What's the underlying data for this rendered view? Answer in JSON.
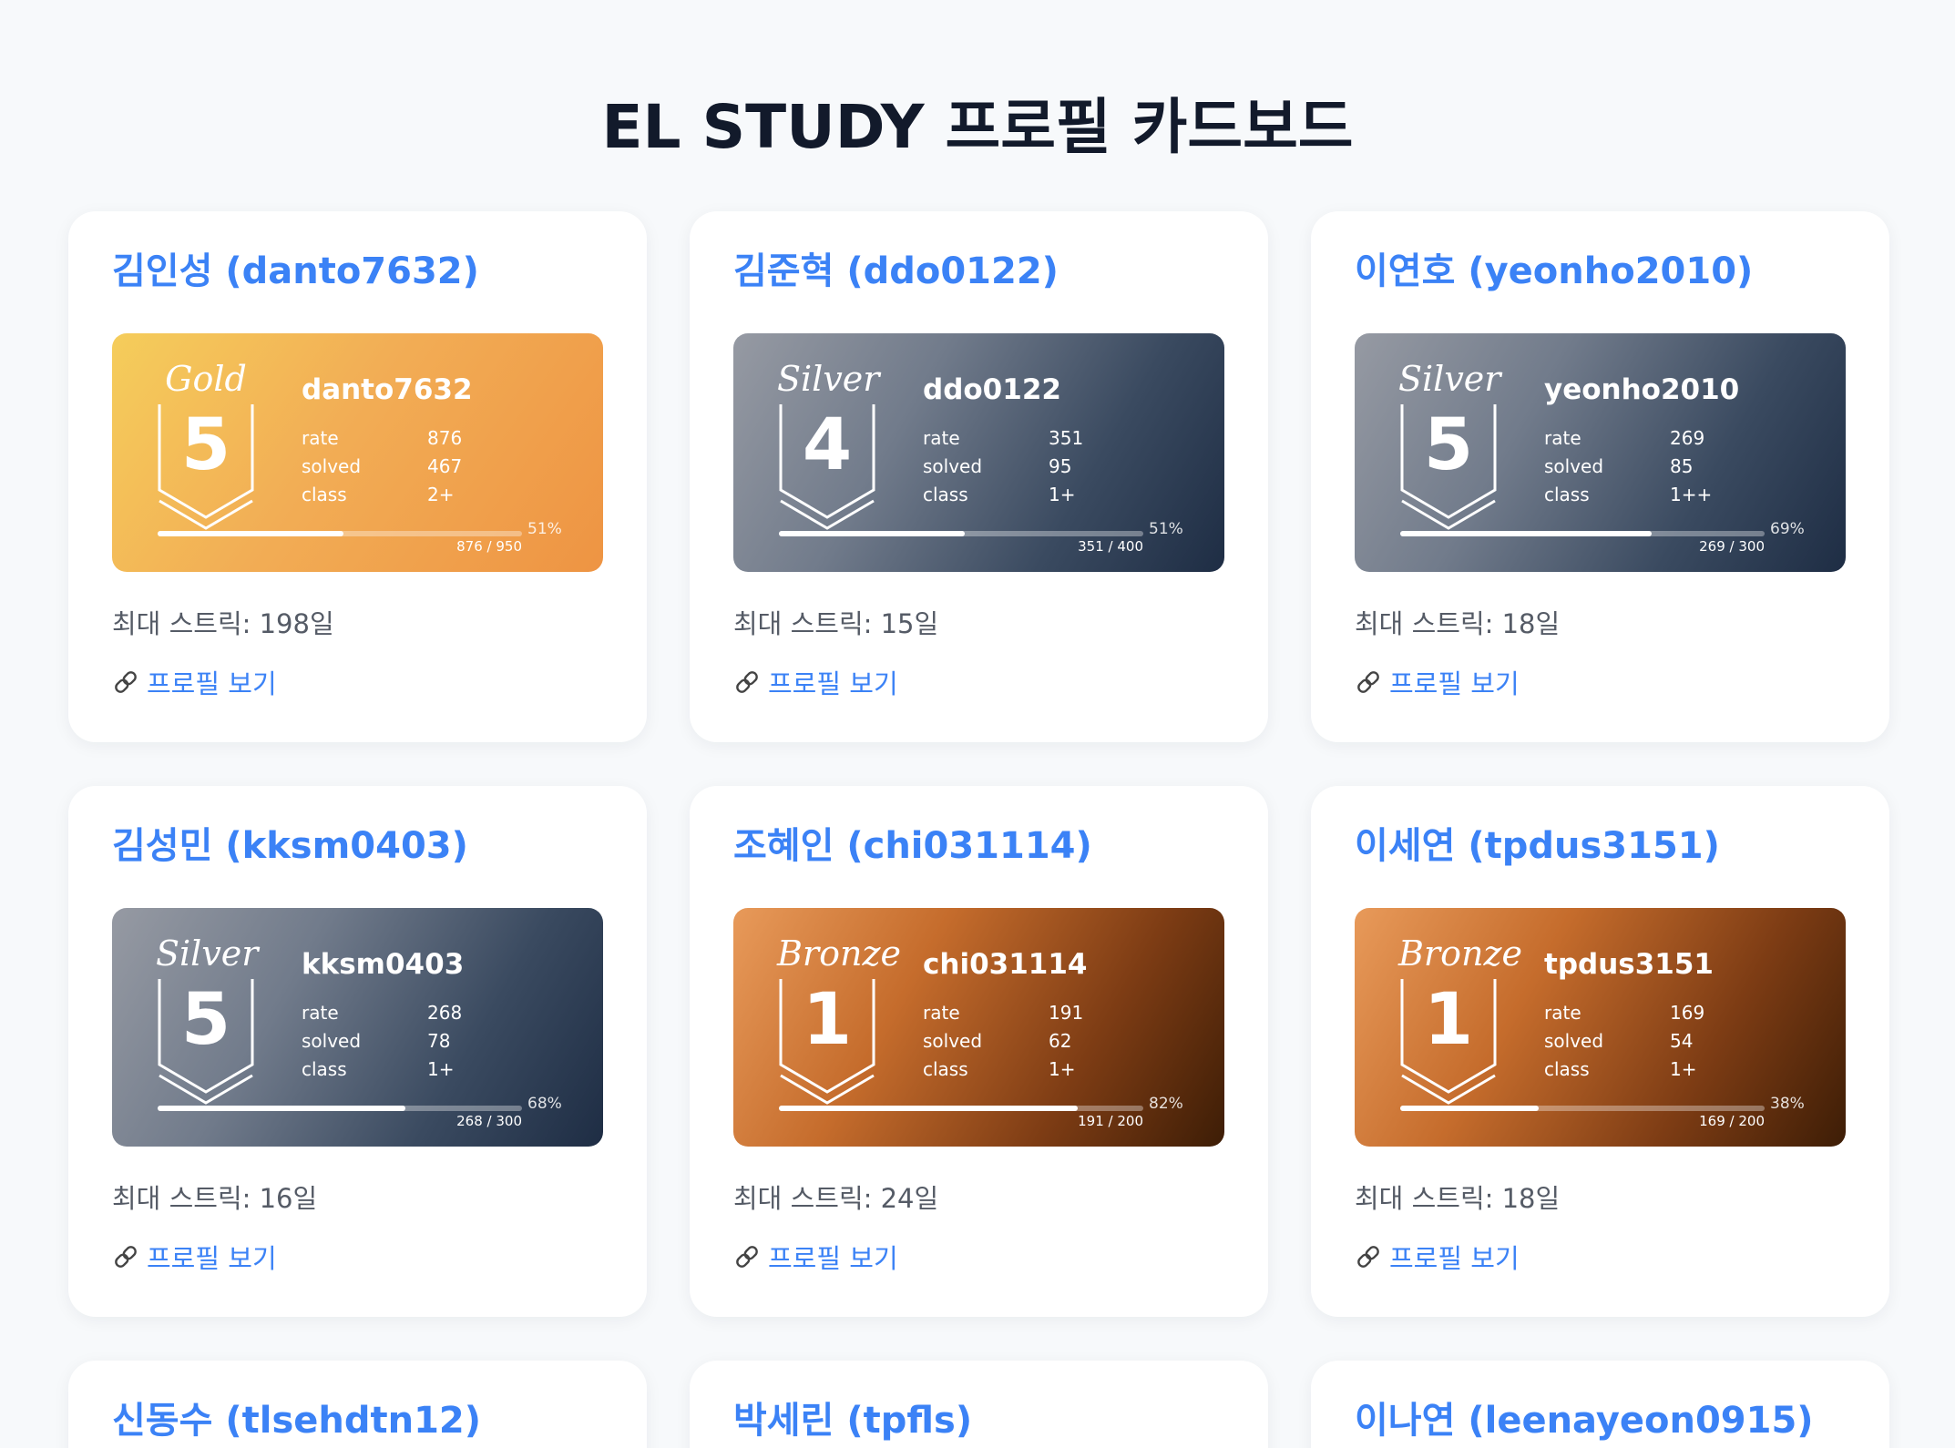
{
  "page": {
    "title": "EL STUDY 프로필 카드보드"
  },
  "colors": {
    "accent": "#3b82f6",
    "gold": "#f2ad55",
    "silver": "#717b8b",
    "bronze": "#c56c2c"
  },
  "cards": [
    {
      "title": "김인성 (danto7632)",
      "tier": "gold",
      "tier_name": "Gold",
      "tier_level": "5",
      "handle": "danto7632",
      "rate_label": "rate",
      "rate": "876",
      "solved_label": "solved",
      "solved": "467",
      "class_label": "class",
      "class": "2+",
      "progress": 0.51,
      "progress_pct": "51%",
      "progress_count": "876 / 950",
      "streak": "최대 스트릭: 198일",
      "link_label": "프로필 보기"
    },
    {
      "title": "김준혁 (ddo0122)",
      "tier": "silver",
      "tier_name": "Silver",
      "tier_level": "4",
      "handle": "ddo0122",
      "rate_label": "rate",
      "rate": "351",
      "solved_label": "solved",
      "solved": "95",
      "class_label": "class",
      "class": "1+",
      "progress": 0.51,
      "progress_pct": "51%",
      "progress_count": "351 / 400",
      "streak": "최대 스트릭: 15일",
      "link_label": "프로필 보기"
    },
    {
      "title": "이연호 (yeonho2010)",
      "tier": "silver",
      "tier_name": "Silver",
      "tier_level": "5",
      "handle": "yeonho2010",
      "rate_label": "rate",
      "rate": "269",
      "solved_label": "solved",
      "solved": "85",
      "class_label": "class",
      "class": "1++",
      "progress": 0.69,
      "progress_pct": "69%",
      "progress_count": "269 / 300",
      "streak": "최대 스트릭: 18일",
      "link_label": "프로필 보기"
    },
    {
      "title": "김성민 (kksm0403)",
      "tier": "silver",
      "tier_name": "Silver",
      "tier_level": "5",
      "handle": "kksm0403",
      "rate_label": "rate",
      "rate": "268",
      "solved_label": "solved",
      "solved": "78",
      "class_label": "class",
      "class": "1+",
      "progress": 0.68,
      "progress_pct": "68%",
      "progress_count": "268 / 300",
      "streak": "최대 스트릭: 16일",
      "link_label": "프로필 보기"
    },
    {
      "title": "조혜인 (chi031114)",
      "tier": "bronze",
      "tier_name": "Bronze",
      "tier_level": "1",
      "handle": "chi031114",
      "rate_label": "rate",
      "rate": "191",
      "solved_label": "solved",
      "solved": "62",
      "class_label": "class",
      "class": "1+",
      "progress": 0.82,
      "progress_pct": "82%",
      "progress_count": "191 / 200",
      "streak": "최대 스트릭: 24일",
      "link_label": "프로필 보기"
    },
    {
      "title": "이세연 (tpdus3151)",
      "tier": "bronze",
      "tier_name": "Bronze",
      "tier_level": "1",
      "handle": "tpdus3151",
      "rate_label": "rate",
      "rate": "169",
      "solved_label": "solved",
      "solved": "54",
      "class_label": "class",
      "class": "1+",
      "progress": 0.38,
      "progress_pct": "38%",
      "progress_count": "169 / 200",
      "streak": "최대 스트릭: 18일",
      "link_label": "프로필 보기"
    }
  ],
  "partial_cards": [
    {
      "title": "신동수 (tlsehdtn12)"
    },
    {
      "title": "박세린 (tpfls)"
    },
    {
      "title": "이나연 (leenayeon0915)"
    }
  ]
}
